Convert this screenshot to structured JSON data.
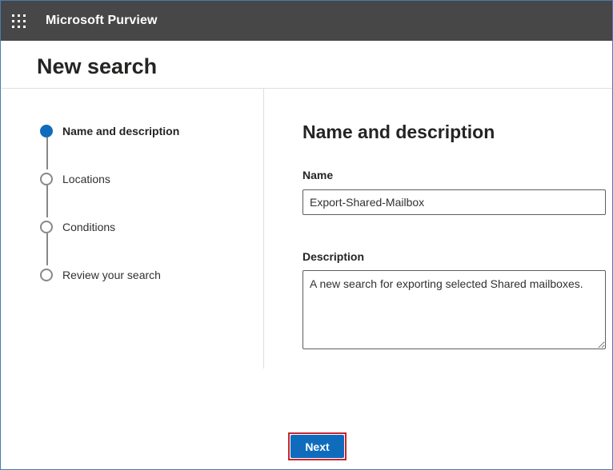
{
  "header": {
    "app_title": "Microsoft Purview",
    "launcher_icon": "waffle-icon"
  },
  "page": {
    "title": "New search"
  },
  "stepper": {
    "steps": [
      {
        "label": "Name and description",
        "state": "current"
      },
      {
        "label": "Locations",
        "state": "upcoming"
      },
      {
        "label": "Conditions",
        "state": "upcoming"
      },
      {
        "label": "Review your search",
        "state": "upcoming"
      }
    ]
  },
  "form": {
    "section_title": "Name and description",
    "name_label": "Name",
    "name_value": "Export-Shared-Mailbox",
    "description_label": "Description",
    "description_value": "A new search for exporting selected Shared mailboxes."
  },
  "footer": {
    "next_label": "Next"
  },
  "colors": {
    "header_bg": "#474747",
    "accent": "#0f6cbd",
    "highlight_border": "#c4262e"
  }
}
